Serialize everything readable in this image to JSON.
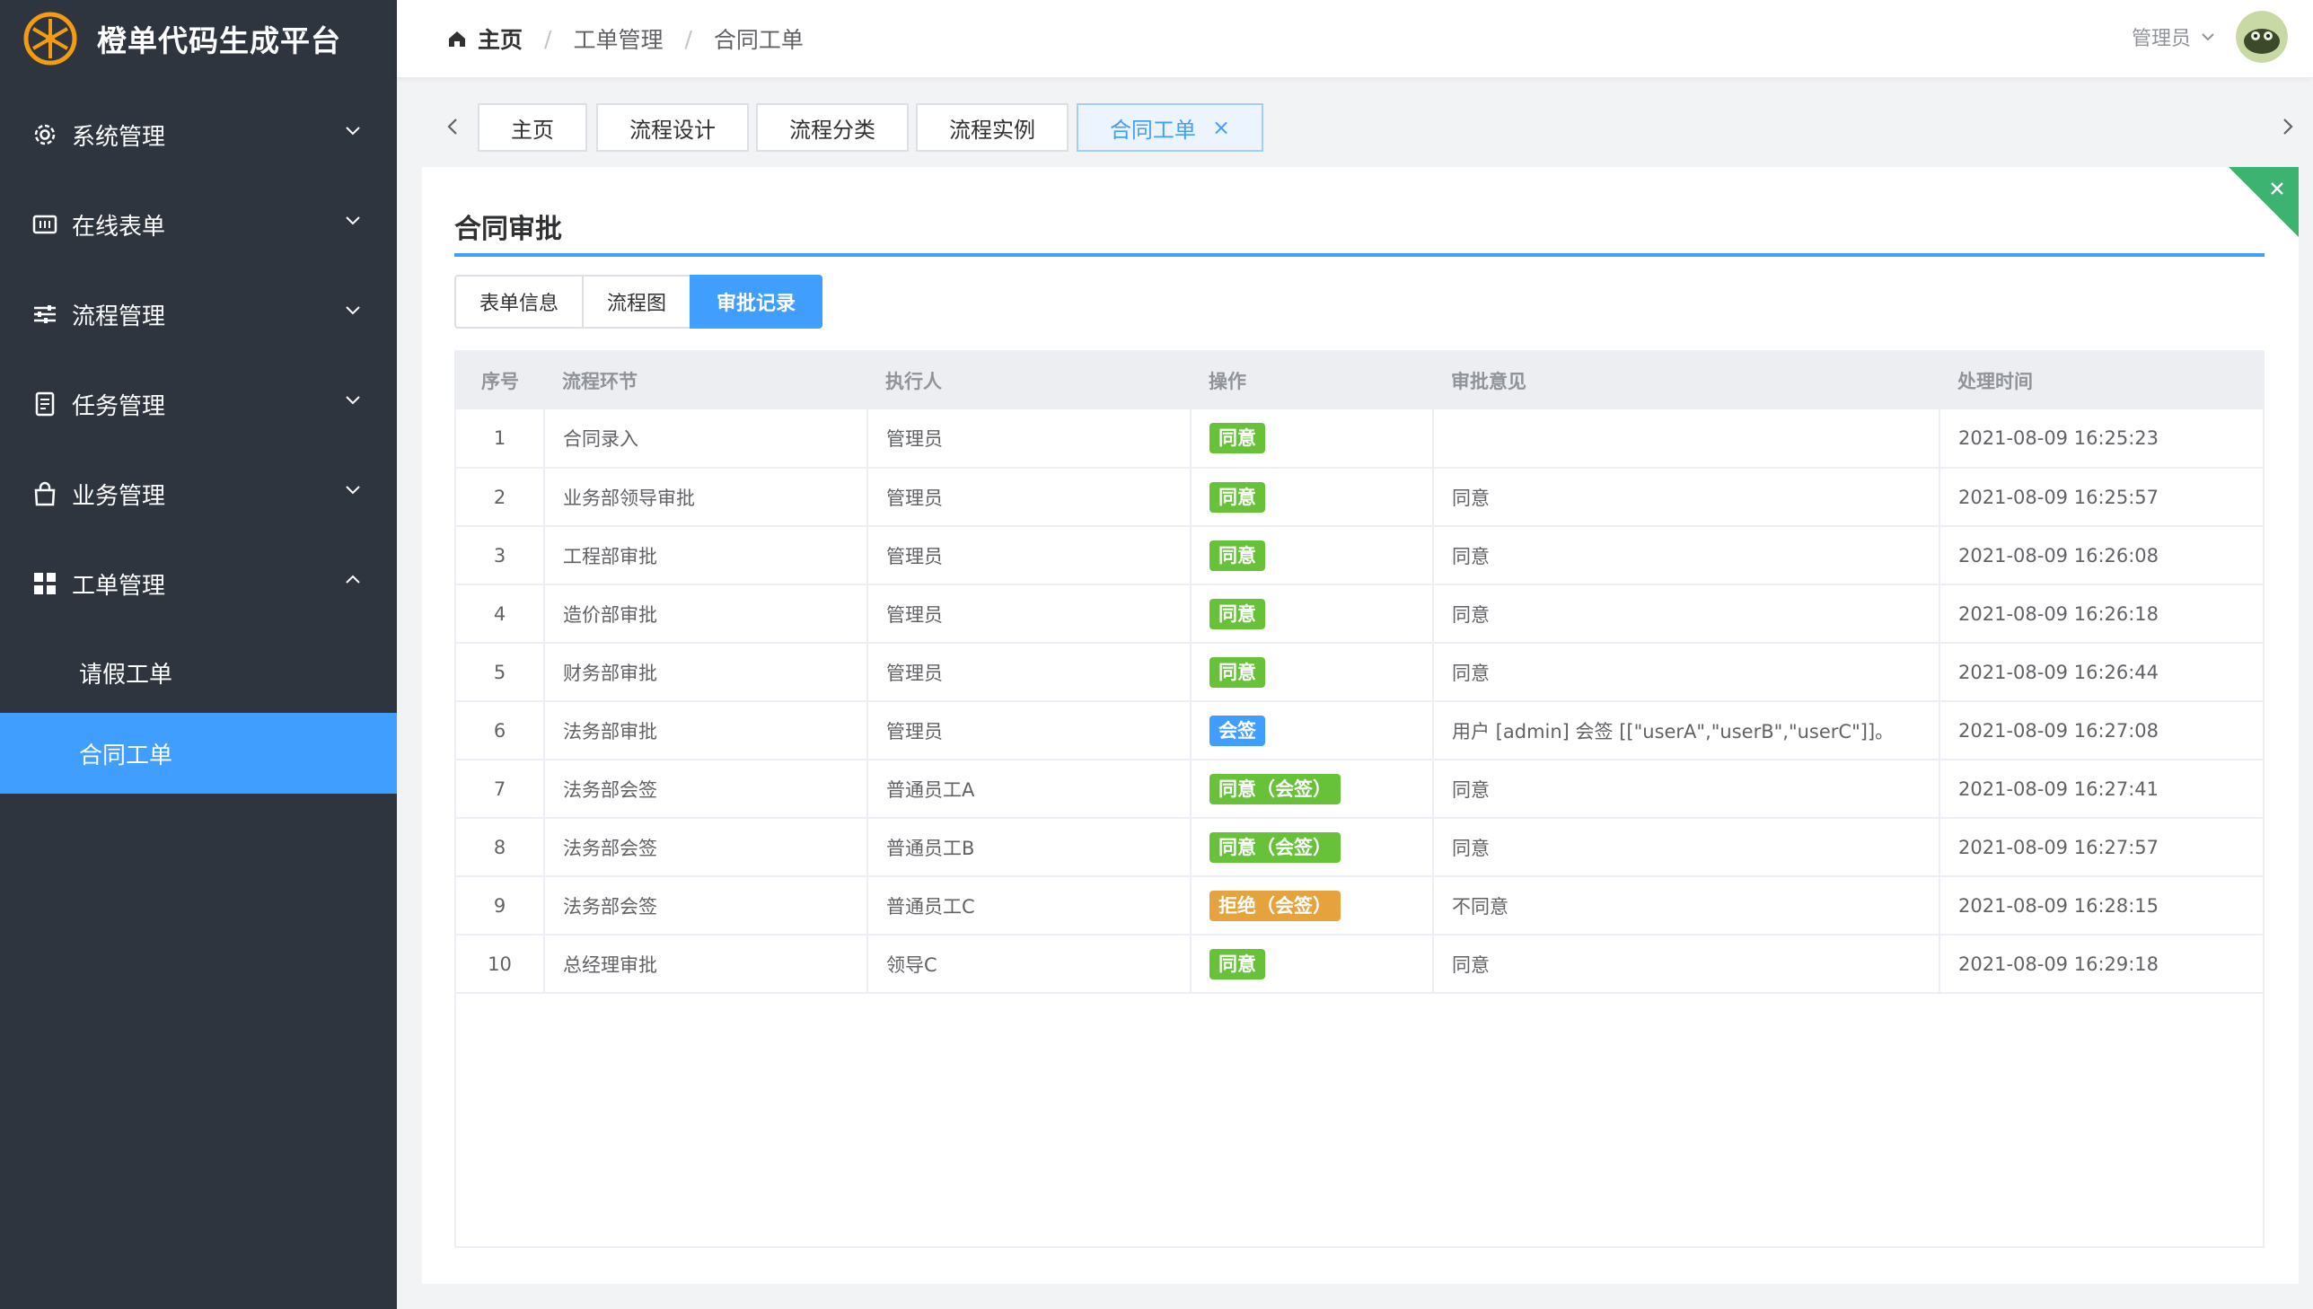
{
  "app": {
    "title": "橙单代码生成平台"
  },
  "sidebar": {
    "items": [
      {
        "label": "系统管理",
        "icon": "gear-icon"
      },
      {
        "label": "在线表单",
        "icon": "form-icon"
      },
      {
        "label": "流程管理",
        "icon": "sliders-icon"
      },
      {
        "label": "任务管理",
        "icon": "document-icon"
      },
      {
        "label": "业务管理",
        "icon": "bag-icon"
      },
      {
        "label": "工单管理",
        "icon": "grid-icon"
      }
    ],
    "subitems": [
      {
        "label": "请假工单"
      },
      {
        "label": "合同工单"
      }
    ]
  },
  "header": {
    "breadcrumb": [
      "主页",
      "工单管理",
      "合同工单"
    ],
    "user": "管理员"
  },
  "tags": [
    {
      "label": "主页"
    },
    {
      "label": "流程设计"
    },
    {
      "label": "流程分类"
    },
    {
      "label": "流程实例"
    },
    {
      "label": "合同工单",
      "close": "×"
    }
  ],
  "page": {
    "title": "合同审批",
    "subtabs": [
      "表单信息",
      "流程图",
      "审批记录"
    ]
  },
  "table": {
    "columns": [
      "序号",
      "流程环节",
      "执行人",
      "操作",
      "审批意见",
      "处理时间"
    ],
    "rows": [
      {
        "idx": "1",
        "step": "合同录入",
        "user": "管理员",
        "op": "同意",
        "comment": "",
        "time": "2021-08-09 16:25:23"
      },
      {
        "idx": "2",
        "step": "业务部领导审批",
        "user": "管理员",
        "op": "同意",
        "comment": "同意",
        "time": "2021-08-09 16:25:57"
      },
      {
        "idx": "3",
        "step": "工程部审批",
        "user": "管理员",
        "op": "同意",
        "comment": "同意",
        "time": "2021-08-09 16:26:08"
      },
      {
        "idx": "4",
        "step": "造价部审批",
        "user": "管理员",
        "op": "同意",
        "comment": "同意",
        "time": "2021-08-09 16:26:18"
      },
      {
        "idx": "5",
        "step": "财务部审批",
        "user": "管理员",
        "op": "同意",
        "comment": "同意",
        "time": "2021-08-09 16:26:44"
      },
      {
        "idx": "6",
        "step": "法务部审批",
        "user": "管理员",
        "op": "会签",
        "comment": "用户 [admin] 会签 [[\"userA\",\"userB\",\"userC\"]]。",
        "time": "2021-08-09 16:27:08"
      },
      {
        "idx": "7",
        "step": "法务部会签",
        "user": "普通员工A",
        "op": "同意（会签）",
        "comment": "同意",
        "time": "2021-08-09 16:27:41"
      },
      {
        "idx": "8",
        "step": "法务部会签",
        "user": "普通员工B",
        "op": "同意（会签）",
        "comment": "同意",
        "time": "2021-08-09 16:27:57"
      },
      {
        "idx": "9",
        "step": "法务部会签",
        "user": "普通员工C",
        "op": "拒绝（会签）",
        "comment": "不同意",
        "time": "2021-08-09 16:28:15"
      },
      {
        "idx": "10",
        "step": "总经理审批",
        "user": "领导C",
        "op": "同意",
        "comment": "同意",
        "time": "2021-08-09 16:29:18"
      }
    ]
  },
  "colors": {
    "sidebar_bg": "#2f353f",
    "accent": "#409eff",
    "approve": "#67c23a",
    "countersign": "#409eff",
    "reject": "#e6a23c"
  }
}
